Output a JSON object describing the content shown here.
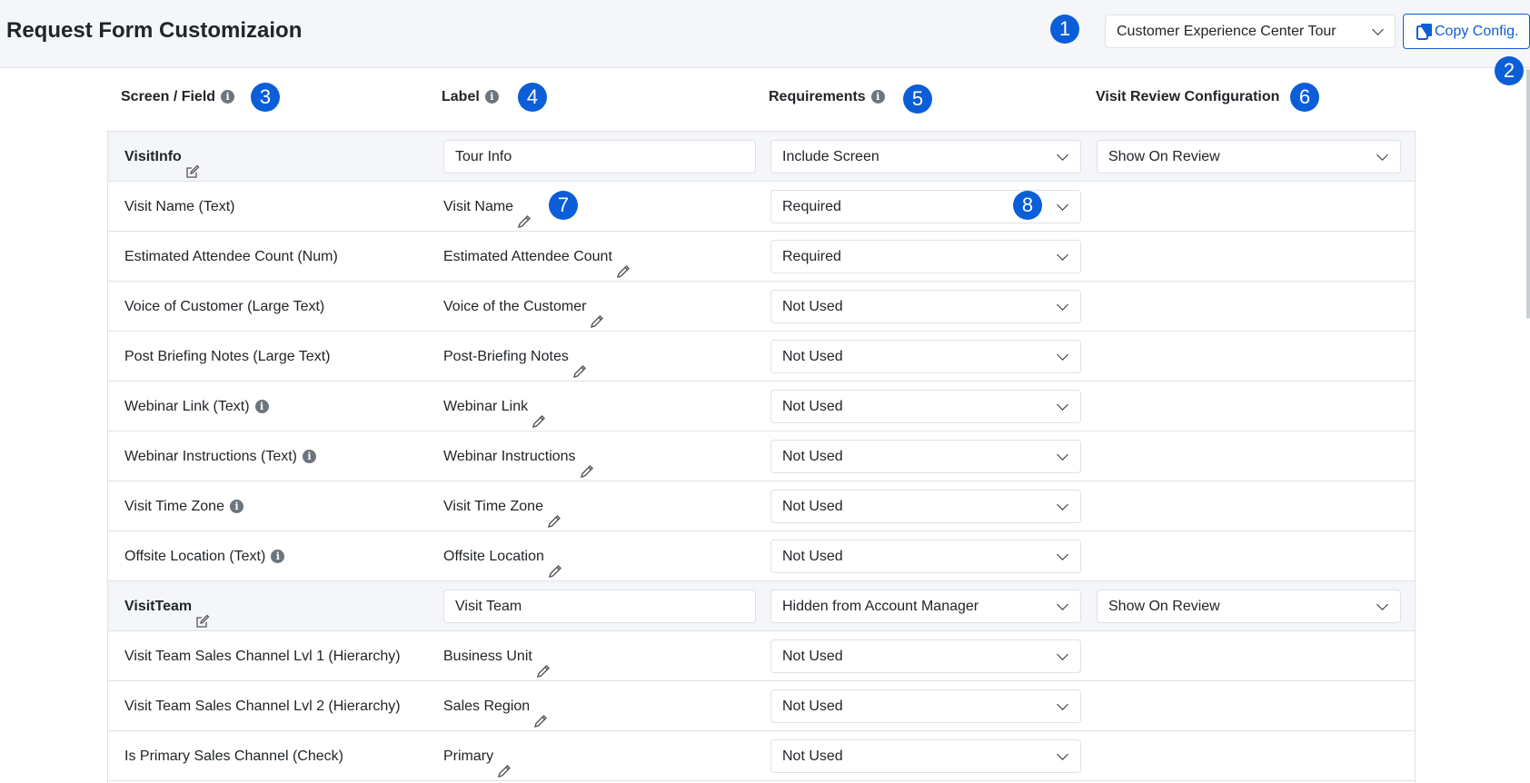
{
  "header": {
    "title": "Request Form Customizaion",
    "config_select": "Customer Experience Center Tour",
    "copy_button": "Copy Config."
  },
  "badges": [
    "1",
    "2",
    "3",
    "4",
    "5",
    "6",
    "7",
    "8"
  ],
  "columns": {
    "field": "Screen / Field",
    "label": "Label",
    "requirements": "Requirements",
    "review": "Visit Review Configuration"
  },
  "rows": [
    {
      "type": "screen",
      "field": "VisitInfo",
      "label": "Tour Info",
      "requirement": "Include Screen",
      "review": "Show On Review"
    },
    {
      "type": "field",
      "field": "Visit Name (Text)",
      "label": "Visit Name",
      "requirement": "Required"
    },
    {
      "type": "field",
      "field": "Estimated Attendee Count (Num)",
      "label": "Estimated Attendee Count",
      "requirement": "Required"
    },
    {
      "type": "field",
      "field": "Voice of Customer (Large Text)",
      "label": "Voice of the Customer",
      "requirement": "Not Used"
    },
    {
      "type": "field",
      "field": "Post Briefing Notes (Large Text)",
      "label": "Post-Briefing Notes",
      "requirement": "Not Used"
    },
    {
      "type": "field",
      "field": "Webinar Link (Text)",
      "info": true,
      "label": "Webinar Link",
      "requirement": "Not Used"
    },
    {
      "type": "field",
      "field": "Webinar Instructions (Text)",
      "info": true,
      "label": "Webinar Instructions",
      "requirement": "Not Used"
    },
    {
      "type": "field",
      "field": "Visit Time Zone",
      "info": true,
      "label": "Visit Time Zone",
      "requirement": "Not Used"
    },
    {
      "type": "field",
      "field": "Offsite Location (Text)",
      "info": true,
      "label": "Offsite Location",
      "requirement": "Not Used"
    },
    {
      "type": "screen",
      "field": "VisitTeam",
      "label": "Visit Team",
      "requirement": "Hidden from Account Manager",
      "review": "Show On Review"
    },
    {
      "type": "field",
      "field": "Visit Team Sales Channel Lvl 1 (Hierarchy)",
      "label": "Business Unit",
      "requirement": "Not Used"
    },
    {
      "type": "field",
      "field": "Visit Team Sales Channel Lvl 2 (Hierarchy)",
      "label": "Sales Region",
      "requirement": "Not Used"
    },
    {
      "type": "field",
      "field": "Is Primary Sales Channel (Check)",
      "label": "Primary",
      "requirement": "Not Used"
    }
  ],
  "colors": {
    "accent": "#0b5ed7",
    "header_bg": "#f4f6f9",
    "border": "#dee2e6"
  },
  "icons": {
    "info": "info-icon",
    "edit": "pencil-icon",
    "screen_edit": "edit-square-icon",
    "copy": "copy-icon",
    "dropdown": "chevron-down-icon"
  }
}
